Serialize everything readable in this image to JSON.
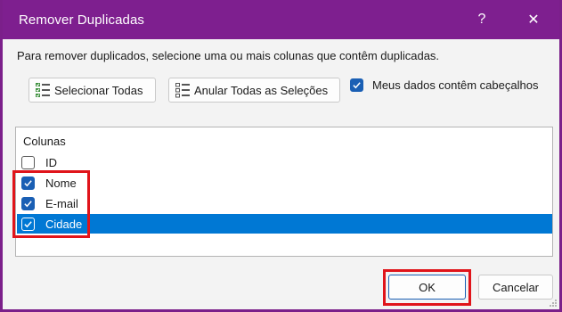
{
  "dialog": {
    "title": "Remover Duplicadas",
    "help_glyph": "?",
    "close_glyph": "✕",
    "instruction": "Para remover duplicados, selecione uma ou mais colunas que contêm duplicadas.",
    "select_all_label": "Selecionar Todas",
    "unselect_all_label": "Anular Todas as Seleções",
    "headers_checkbox": {
      "label": "Meus dados contêm cabeçalhos",
      "checked": true
    },
    "columns": {
      "header": "Colunas",
      "items": [
        {
          "label": "ID",
          "checked": false,
          "selected": false
        },
        {
          "label": "Nome",
          "checked": true,
          "selected": false
        },
        {
          "label": "E-mail",
          "checked": true,
          "selected": false
        },
        {
          "label": "Cidade",
          "checked": true,
          "selected": true
        }
      ]
    },
    "ok_label": "OK",
    "cancel_label": "Cancelar"
  },
  "colors": {
    "titlebar": "#7e1f8f",
    "checkbox_accent": "#1a5fb4",
    "selection": "#0078d4",
    "highlight_box": "#e0141a"
  }
}
